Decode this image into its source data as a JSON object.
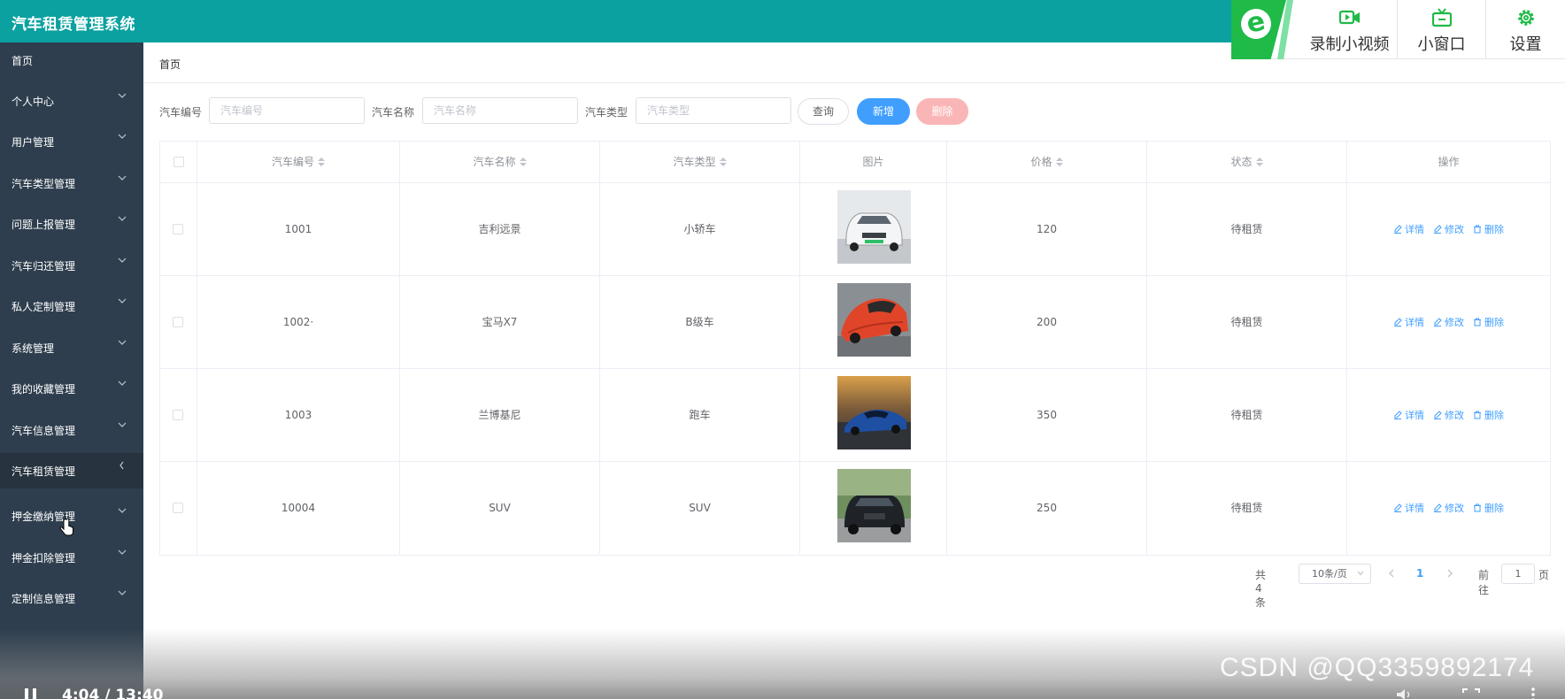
{
  "app": {
    "title": "汽车租赁管理系统"
  },
  "toolbar_overlay": {
    "brand": "e",
    "record_label": "录制小视频",
    "mini_window_label": "小窗口",
    "settings_label": "设置"
  },
  "sidebar": {
    "items": [
      {
        "label": "首页",
        "has_arrow": false
      },
      {
        "label": "个人中心",
        "has_arrow": true
      },
      {
        "label": "用户管理",
        "has_arrow": true
      },
      {
        "label": "汽车类型管理",
        "has_arrow": true
      },
      {
        "label": "问题上报管理",
        "has_arrow": true
      },
      {
        "label": "汽车归还管理",
        "has_arrow": true
      },
      {
        "label": "私人定制管理",
        "has_arrow": true
      },
      {
        "label": "系统管理",
        "has_arrow": true
      },
      {
        "label": "我的收藏管理",
        "has_arrow": true
      },
      {
        "label": "汽车信息管理",
        "has_arrow": true
      },
      {
        "label": "汽车租赁管理",
        "has_arrow": true,
        "active": true
      },
      {
        "label": "押金缴纳管理",
        "has_arrow": true
      },
      {
        "label": "押金扣除管理",
        "has_arrow": true
      },
      {
        "label": "定制信息管理",
        "has_arrow": true
      }
    ]
  },
  "breadcrumb": {
    "current": "首页"
  },
  "search": {
    "car_no_label": "汽车编号",
    "car_no_placeholder": "汽车编号",
    "car_name_label": "汽车名称",
    "car_name_placeholder": "汽车名称",
    "car_type_label": "汽车类型",
    "car_type_placeholder": "汽车类型",
    "query_label": "查询",
    "add_label": "新增",
    "delete_label": "删除"
  },
  "table": {
    "columns": [
      "汽车编号",
      "汽车名称",
      "汽车类型",
      "图片",
      "价格",
      "状态",
      "操作"
    ],
    "rows": [
      {
        "no": "1001",
        "name": "吉利远景",
        "type": "小轿车",
        "image": "white-car-photo",
        "price": "120",
        "status": "待租赁"
      },
      {
        "no": "1002·",
        "name": "宝马X7",
        "type": "B级车",
        "image": "red-car-photo",
        "price": "200",
        "status": "待租赁"
      },
      {
        "no": "1003",
        "name": "兰博基尼",
        "type": "跑车",
        "image": "blue-sports-car-photo",
        "price": "350",
        "status": "待租赁"
      },
      {
        "no": "10004",
        "name": "SUV",
        "type": "SUV",
        "image": "black-suv-photo",
        "price": "250",
        "status": "待租赁"
      }
    ],
    "actions": {
      "detail": "详情",
      "edit": "修改",
      "delete": "删除"
    }
  },
  "pagination": {
    "total_text": "共 4 条",
    "page_size": "10条/页",
    "current_page": "1",
    "goto_label": "前往",
    "goto_value": "1",
    "page_suffix": "页"
  },
  "video_player": {
    "time": "4:04 / 13:40"
  },
  "watermark": "CSDN @QQ3359892174",
  "colors": {
    "header": "#0aa1a0",
    "sidebar": "#2e3e4e",
    "primary": "#409eff",
    "danger_light": "#fab6b6"
  }
}
